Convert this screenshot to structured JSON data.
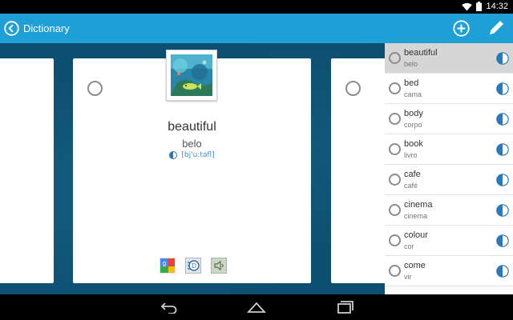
{
  "status_bar": {
    "time": "14:32"
  },
  "action_bar": {
    "title": "Dictionary"
  },
  "card": {
    "word": "beautiful",
    "translation": "belo",
    "phonetic": "[bj'u:təfl]"
  },
  "word_list": [
    {
      "word": "beautiful",
      "translation": "belo",
      "selected": true
    },
    {
      "word": "bed",
      "translation": "cama"
    },
    {
      "word": "body",
      "translation": "corpo"
    },
    {
      "word": "book",
      "translation": "livro"
    },
    {
      "word": "cafe",
      "translation": "café"
    },
    {
      "word": "cinema",
      "translation": "cinema"
    },
    {
      "word": "colour",
      "translation": "cor"
    },
    {
      "word": "come",
      "translation": "vir"
    }
  ],
  "icons": {
    "back": "back-arrow-circle-icon",
    "add": "add-circle-icon",
    "edit": "pencil-icon",
    "audio": "speaker-icon",
    "tools": [
      "google-translate-icon",
      "dictionary-icon",
      "speak-icon"
    ]
  },
  "colors": {
    "accent": "#1e9fd6",
    "content_bg": "#0d4f70",
    "phonetic": "#3a8fd0",
    "selected_row": "#d6d6d6"
  }
}
